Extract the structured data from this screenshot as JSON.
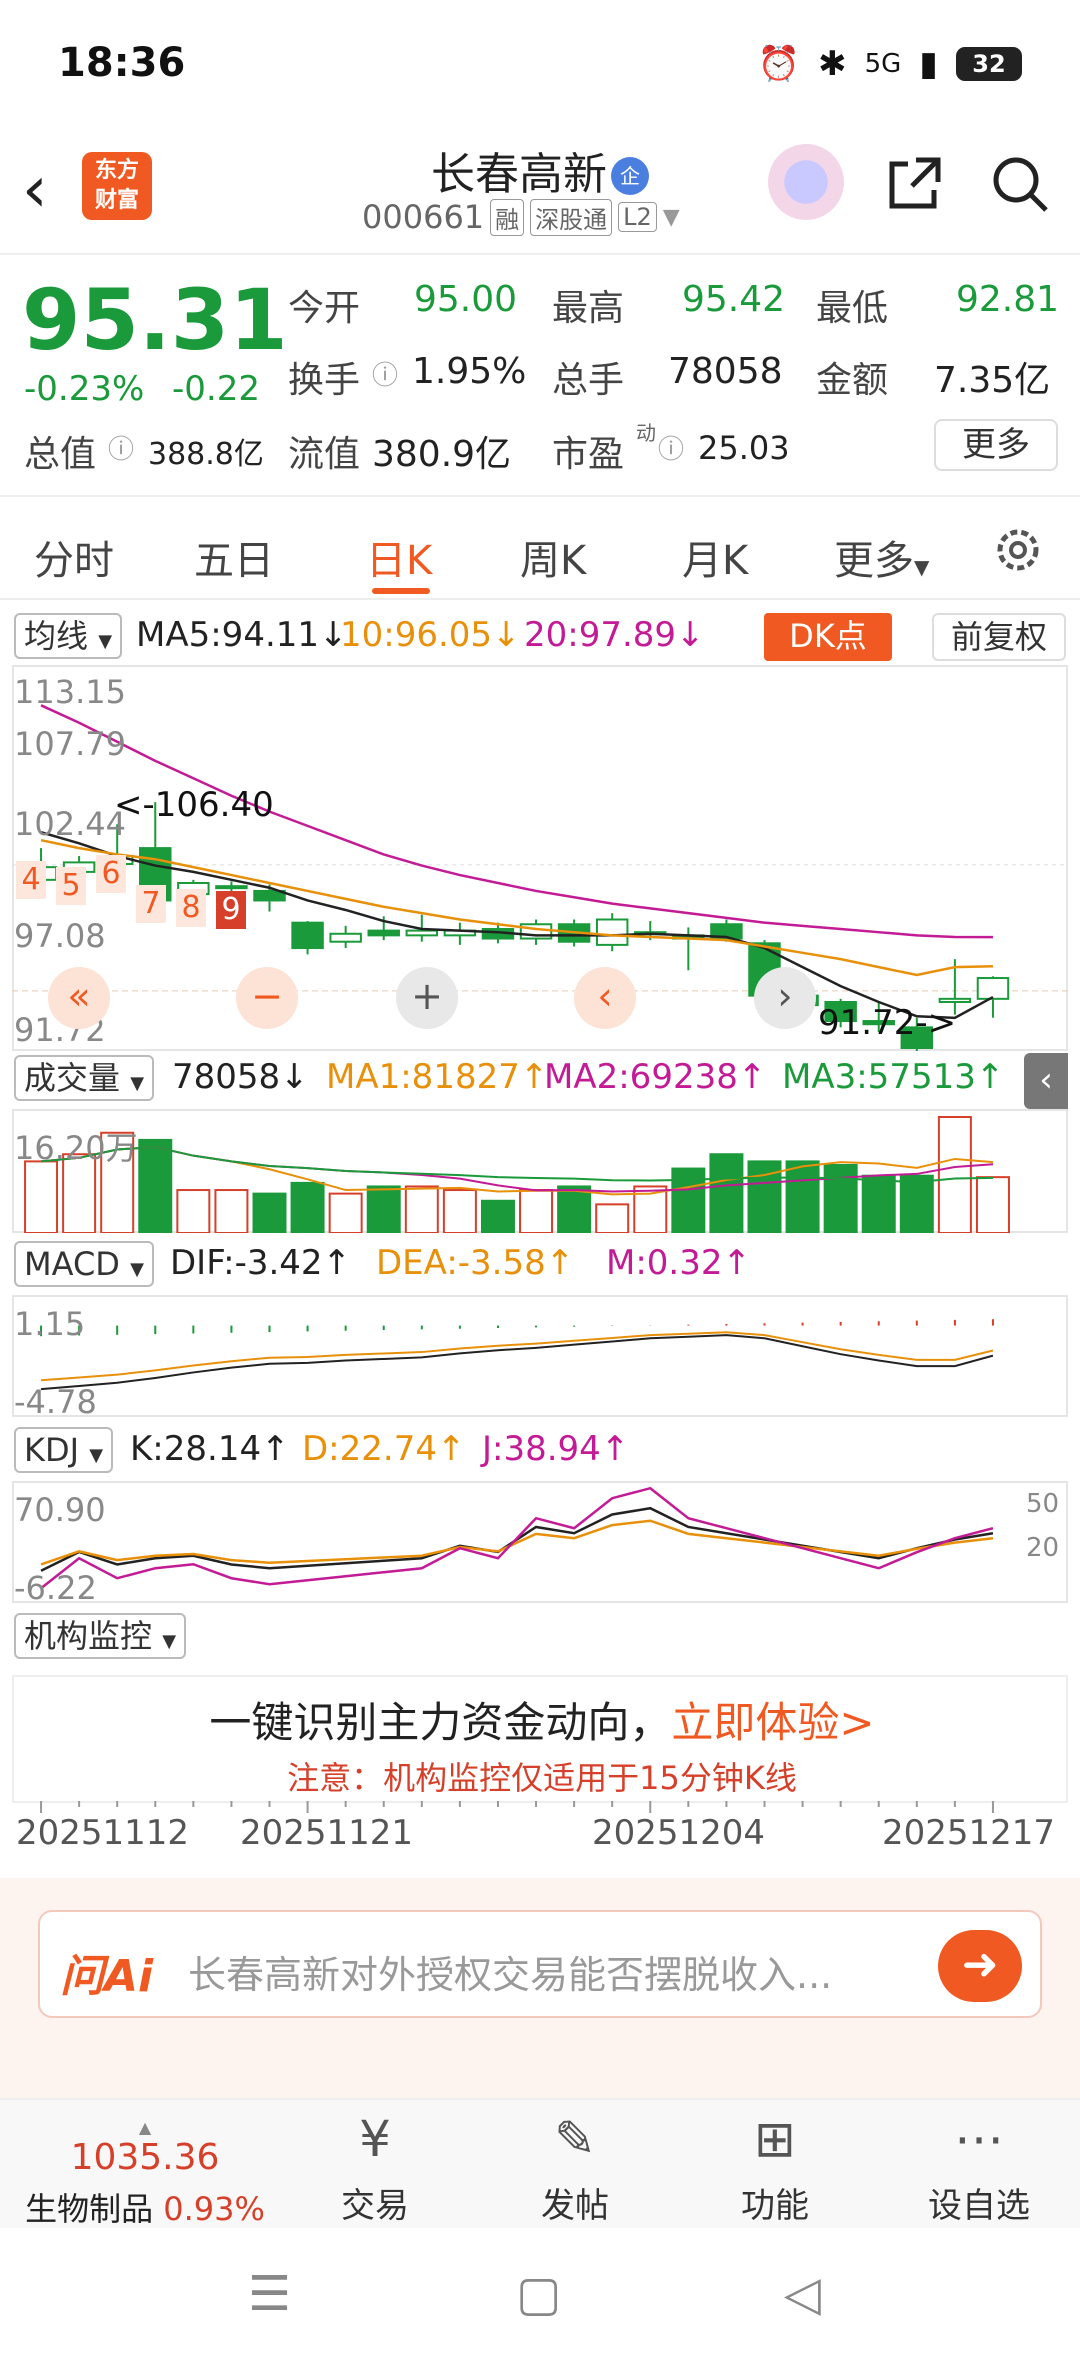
{
  "status": {
    "time": "18:36",
    "battery": "32",
    "signal": "5G"
  },
  "header": {
    "title": "长春高新",
    "badge": "企",
    "code": "000661",
    "tags": [
      "融",
      "深股通",
      "L2"
    ]
  },
  "logo": {
    "line1": "东方",
    "line2": "财富"
  },
  "quote": {
    "price": "95.31",
    "pct": "-0.23%",
    "chg": "-0.22",
    "fields": [
      {
        "label": "今开",
        "value": "95.00"
      },
      {
        "label": "最高",
        "value": "95.42"
      },
      {
        "label": "最低",
        "value": "92.81"
      },
      {
        "label": "换手",
        "value": "1.95%"
      },
      {
        "label": "总手",
        "value": "78058"
      },
      {
        "label": "金额",
        "value": "7.35亿"
      }
    ],
    "total_label": "总值",
    "total_value": "388.8亿",
    "float_label": "流值",
    "float_value": "380.9亿",
    "pe_label": "市盈",
    "pe_sup": "动",
    "pe_value": "25.03",
    "more": "更多"
  },
  "tabs": [
    "分时",
    "五日",
    "日K",
    "周K",
    "月K",
    "更多"
  ],
  "chart": {
    "ma_pill": "均线",
    "ma5": "MA5:94.11↓",
    "ma10": "10:96.05↓",
    "ma20": "20:97.89↓",
    "dk": "DK点",
    "fq": "前复权",
    "price_axis": [
      "113.15",
      "107.79",
      "102.44",
      "97.08",
      "91.72"
    ],
    "high_note": "<-106.40",
    "low_note": "91.72->",
    "days": [
      "4",
      "5",
      "6",
      "7",
      "8",
      "9"
    ],
    "vol_pill": "成交量",
    "vol": "78058↓",
    "vol_ma1": "MA1:81827↑",
    "vol_ma2": "MA2:69238↑",
    "vol_ma3": "MA3:57513↑",
    "vol_axis": "16.20万",
    "macd_pill": "MACD",
    "dif": "DIF:-3.42↑",
    "dea": "DEA:-3.58↑",
    "m": "M:0.32↑",
    "macd_axis": [
      "1.15",
      "-4.78"
    ],
    "kdj_pill": "KDJ",
    "k": "K:28.14↑",
    "d": "D:22.74↑",
    "j": "J:38.94↑",
    "kdj_axis": [
      "70.90",
      "-6.22"
    ],
    "kdj_right": [
      "50",
      "20"
    ],
    "jg_pill": "机构监控",
    "promo_a": "一键识别主力资金动向，",
    "promo_b": "立即体验>",
    "promo_note": "注意：机构监控仅适用于15分钟K线",
    "dates": [
      "20251112",
      "20251121",
      "20251204",
      "20251217"
    ]
  },
  "chart_data": {
    "type": "candlestick",
    "candles": [
      {
        "o": 101.5,
        "h": 103.5,
        "l": 100.8,
        "c": 102.3
      },
      {
        "o": 102.0,
        "h": 103.0,
        "l": 101.0,
        "c": 102.6
      },
      {
        "o": 102.5,
        "h": 105.0,
        "l": 101.8,
        "c": 103.0
      },
      {
        "o": 103.5,
        "h": 106.4,
        "l": 100.0,
        "c": 100.2
      },
      {
        "o": 100.6,
        "h": 101.5,
        "l": 99.8,
        "c": 101.3
      },
      {
        "o": 101.0,
        "h": 101.4,
        "l": 100.0,
        "c": 101.1
      },
      {
        "o": 100.8,
        "h": 101.2,
        "l": 99.5,
        "c": 100.2
      },
      {
        "o": 98.8,
        "h": 98.9,
        "l": 96.8,
        "c": 97.2
      },
      {
        "o": 97.6,
        "h": 98.6,
        "l": 97.2,
        "c": 98.1
      },
      {
        "o": 98.3,
        "h": 99.2,
        "l": 97.7,
        "c": 98.0
      },
      {
        "o": 98.0,
        "h": 99.3,
        "l": 97.6,
        "c": 98.3
      },
      {
        "o": 98.0,
        "h": 98.8,
        "l": 97.4,
        "c": 98.3
      },
      {
        "o": 98.4,
        "h": 98.8,
        "l": 97.5,
        "c": 97.8
      },
      {
        "o": 97.8,
        "h": 99.0,
        "l": 97.4,
        "c": 98.7
      },
      {
        "o": 98.7,
        "h": 99.0,
        "l": 97.3,
        "c": 97.6
      },
      {
        "o": 97.4,
        "h": 99.4,
        "l": 97.0,
        "c": 99.0
      },
      {
        "o": 98.2,
        "h": 98.9,
        "l": 97.7,
        "c": 98.2
      },
      {
        "o": 98.0,
        "h": 98.5,
        "l": 95.8,
        "c": 97.8
      },
      {
        "o": 98.7,
        "h": 99.0,
        "l": 97.6,
        "c": 97.8
      },
      {
        "o": 97.5,
        "h": 97.7,
        "l": 93.2,
        "c": 94.2
      },
      {
        "o": 94.2,
        "h": 95.0,
        "l": 93.0,
        "c": 93.6
      },
      {
        "o": 93.8,
        "h": 94.0,
        "l": 92.2,
        "c": 92.6
      },
      {
        "o": 92.6,
        "h": 93.8,
        "l": 91.9,
        "c": 92.4
      },
      {
        "o": 92.2,
        "h": 92.8,
        "l": 90.5,
        "c": 90.9
      },
      {
        "o": 93.8,
        "h": 96.5,
        "l": 93.0,
        "c": 94.0
      },
      {
        "o": 94.0,
        "h": 95.42,
        "l": 92.81,
        "c": 95.31
      }
    ],
    "ma5": [
      104.5,
      103.8,
      103.0,
      102.4,
      102.0,
      101.5,
      101.0,
      100.2,
      99.6,
      98.9,
      98.4,
      98.3,
      98.2,
      98.0,
      98.0,
      98.0,
      98.1,
      98.0,
      97.9,
      97.2,
      96.0,
      94.8,
      93.8,
      92.9,
      92.8,
      94.11
    ],
    "ma10": [
      104.0,
      103.5,
      103.1,
      102.8,
      102.3,
      101.8,
      101.3,
      100.8,
      100.3,
      99.8,
      99.4,
      99.0,
      98.7,
      98.4,
      98.2,
      98.0,
      97.9,
      97.8,
      97.7,
      97.3,
      96.9,
      96.5,
      96.0,
      95.5,
      96.0,
      96.05
    ],
    "ma20": [
      112.5,
      111.4,
      110.2,
      109.0,
      107.9,
      106.8,
      105.8,
      104.9,
      104.0,
      103.1,
      102.4,
      101.8,
      101.3,
      100.8,
      100.4,
      100.0,
      99.7,
      99.4,
      99.1,
      98.8,
      98.6,
      98.4,
      98.2,
      98.0,
      97.9,
      97.89
    ],
    "volume": [
      10,
      11,
      14,
      13,
      6,
      6,
      5.5,
      7,
      5.5,
      6.5,
      6.5,
      6,
      4.5,
      6,
      6.5,
      4,
      6.5,
      9,
      11,
      10,
      10,
      9.5,
      8,
      8,
      16.2,
      7.8
    ],
    "price_ylim": [
      91.72,
      113.15
    ],
    "volume_ymax": 16.2
  }
}
